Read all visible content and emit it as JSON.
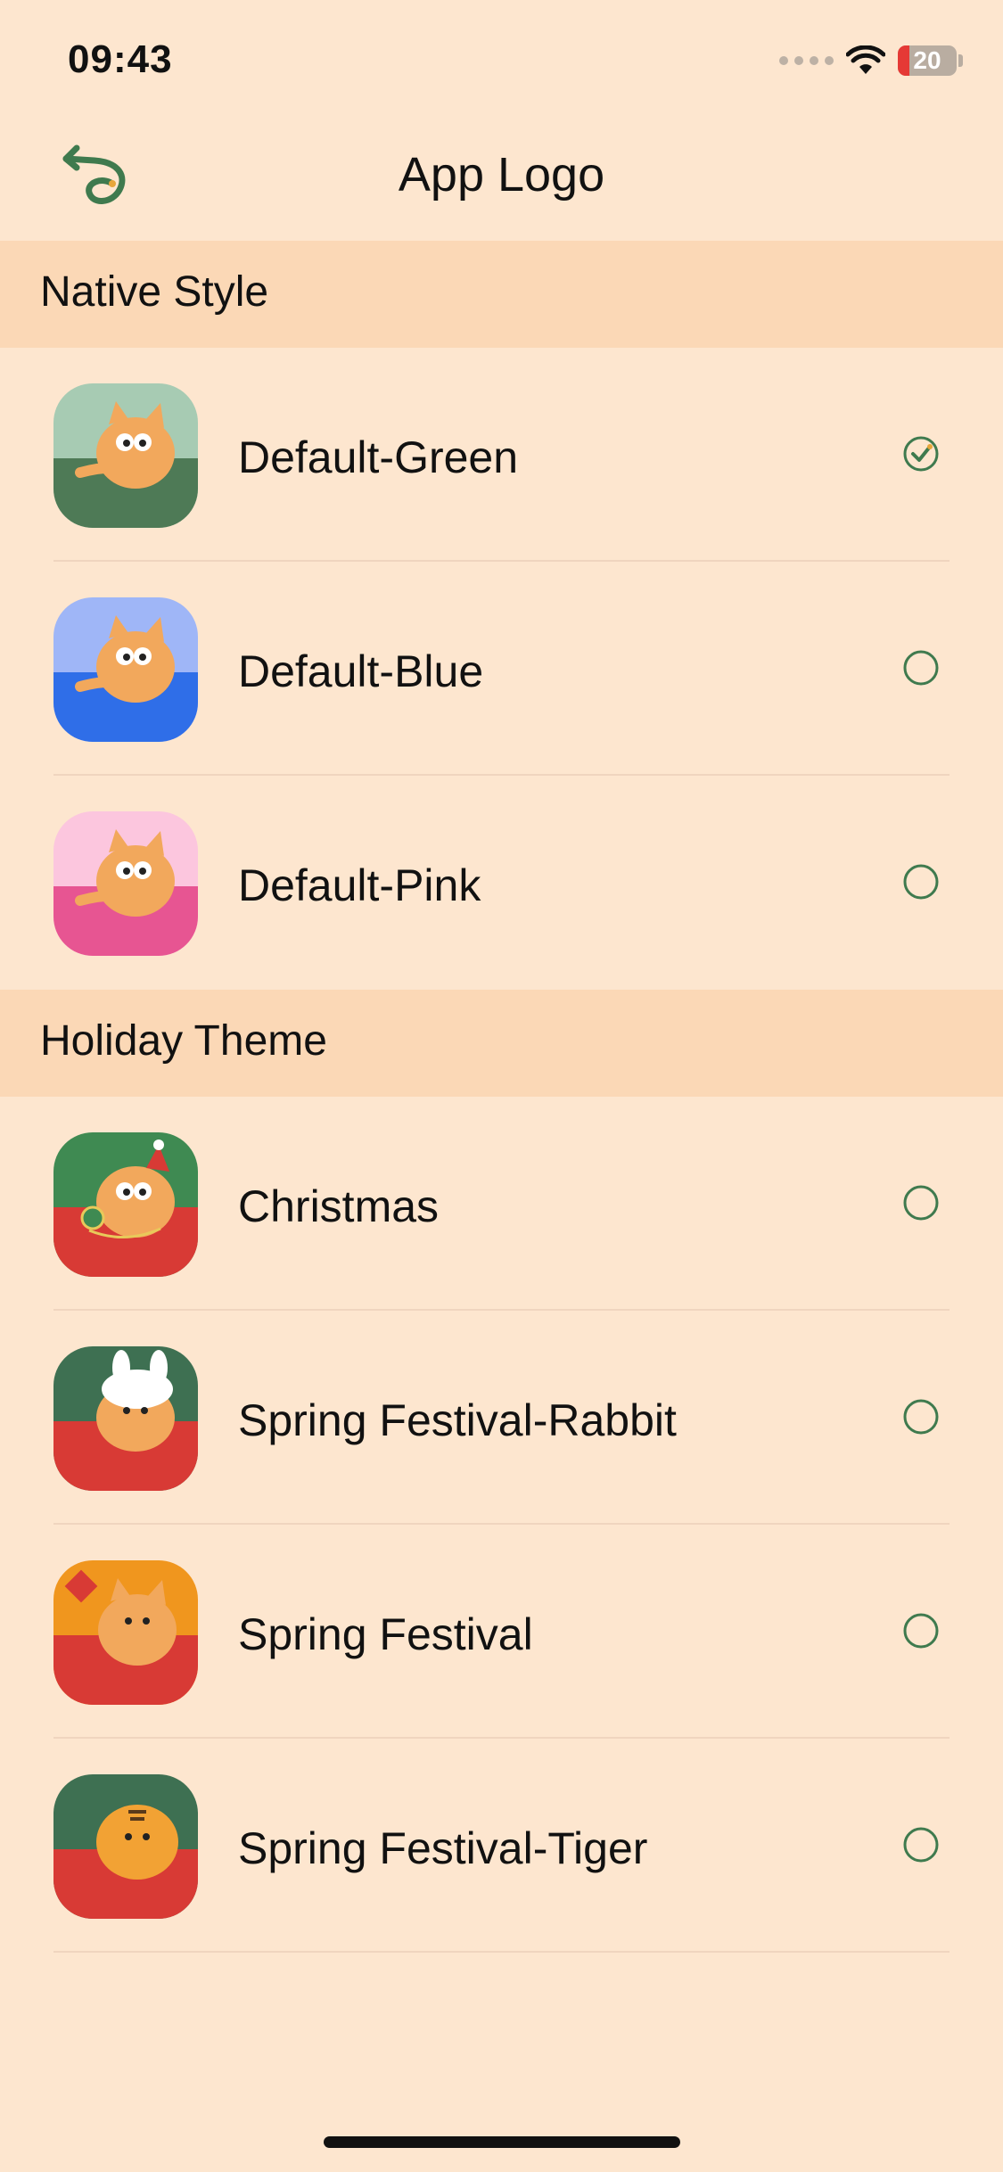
{
  "status_bar": {
    "time": "09:43",
    "battery": "20",
    "icons": [
      "signal-dots-icon",
      "wifi-icon",
      "battery-icon"
    ]
  },
  "nav": {
    "title": "App Logo",
    "back_icon": "back-arrow-icon"
  },
  "sections": [
    {
      "title": "Native Style",
      "items": [
        {
          "label": "Default-Green",
          "selected": true,
          "top_color": "#a7cbb3",
          "bottom_color": "#4e7a56"
        },
        {
          "label": "Default-Blue",
          "selected": false,
          "top_color": "#9fb6f7",
          "bottom_color": "#2f6ee8"
        },
        {
          "label": "Default-Pink",
          "selected": false,
          "top_color": "#fcc6de",
          "bottom_color": "#e75592"
        }
      ]
    },
    {
      "title": "Holiday Theme",
      "items": [
        {
          "label": "Christmas",
          "selected": false,
          "top_color": "#3f8a52",
          "bottom_color": "#d83a35"
        },
        {
          "label": "Spring Festival-Rabbit",
          "selected": false,
          "top_color": "#3e7052",
          "bottom_color": "#d83a35"
        },
        {
          "label": "Spring Festival",
          "selected": false,
          "top_color": "#f0961e",
          "bottom_color": "#d83a35"
        },
        {
          "label": "Spring Festival-Tiger",
          "selected": false,
          "top_color": "#3e7052",
          "bottom_color": "#d83a35"
        }
      ]
    }
  ],
  "colors": {
    "background": "#fde6cf",
    "section_header": "#fbd8b6",
    "radio": "#3f7a4e",
    "battery_low": "#e53935"
  }
}
